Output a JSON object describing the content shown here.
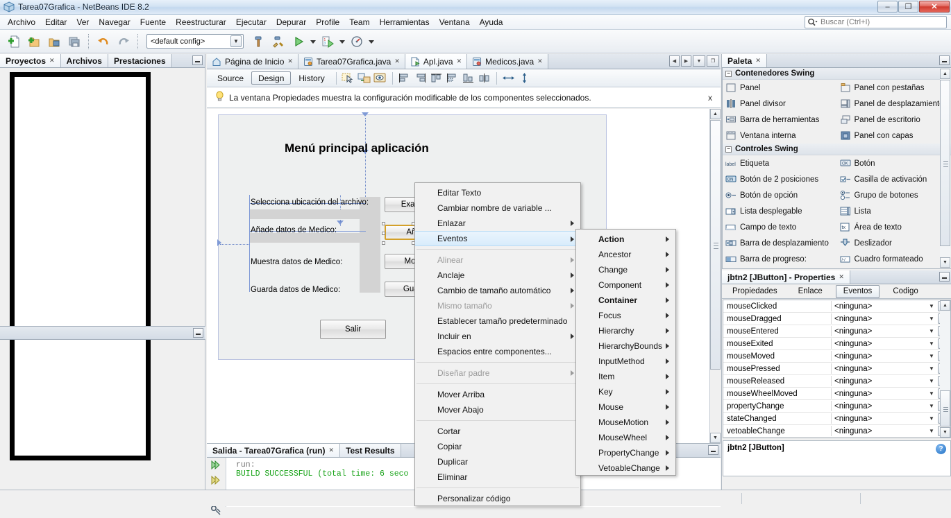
{
  "window": {
    "title": "Tarea07Grafica - NetBeans IDE 8.2",
    "app_icon": "netbeans-icon",
    "minimize": "–",
    "restore": "❐",
    "close": "✕"
  },
  "menubar": {
    "items": [
      "Archivo",
      "Editar",
      "Ver",
      "Navegar",
      "Fuente",
      "Reestructurar",
      "Ejecutar",
      "Depurar",
      "Profile",
      "Team",
      "Herramientas",
      "Ventana",
      "Ayuda"
    ]
  },
  "search": {
    "placeholder": "Buscar (Ctrl+I)",
    "icon": "search-icon"
  },
  "toolbar": {
    "config_value": "<default config>",
    "buttons": [
      "new-file-icon",
      "new-project-icon",
      "open-project-icon",
      "save-all-icon",
      "undo-icon",
      "redo-icon",
      "build-project-icon",
      "clean-build-icon",
      "run-project-icon",
      "debug-project-icon",
      "profile-project-icon"
    ]
  },
  "left_panel": {
    "tabs": [
      {
        "label": "Proyectos",
        "closable": true,
        "active": true
      },
      {
        "label": "Archivos",
        "closable": false,
        "active": false
      },
      {
        "label": "Prestaciones",
        "closable": false,
        "active": false
      }
    ],
    "minimize_label": "minimize"
  },
  "editor": {
    "tabs": [
      {
        "label": "Página de Inicio",
        "icon": "home-icon",
        "closable": true,
        "active": false
      },
      {
        "label": "Tarea07Grafica.java",
        "icon": "java-form-icon",
        "closable": true,
        "active": false
      },
      {
        "label": "Apl.java",
        "icon": "java-file-icon",
        "closable": true,
        "active": true
      },
      {
        "label": "Medicos.java",
        "icon": "java-form-icon",
        "closable": true,
        "active": false
      }
    ],
    "nav": [
      "◀",
      "▶",
      "▼",
      "❐"
    ],
    "view_tabs": [
      {
        "label": "Source",
        "selected": false
      },
      {
        "label": "Design",
        "selected": true
      },
      {
        "label": "History",
        "selected": false
      }
    ],
    "design_tools": [
      "selection-mode-icon",
      "connection-mode-icon",
      "preview-design-icon",
      "align-left-icon",
      "align-right-icon",
      "align-top-icon",
      "align-center-h-icon",
      "align-bottom-icon",
      "align-center-v-icon",
      "resize-horizontal-icon",
      "resize-vertical-icon"
    ],
    "hint": {
      "icon": "lightbulb-icon",
      "text": "La ventana Propiedades muestra la configuración modificable de los componentes seleccionados.",
      "close": "x"
    }
  },
  "design_form": {
    "title": "Menú principal aplicación",
    "rows": [
      {
        "label": "Selecciona ubicación del archivo:",
        "button": "Examinar"
      },
      {
        "label": "Añade datos de Medico:",
        "button": "Añadir",
        "selected": true
      },
      {
        "label": "Muestra datos de Medico:",
        "button": "Mostrar"
      },
      {
        "label": "Guarda datos de Medico:",
        "button": "Guardar"
      }
    ],
    "exit_button": "Salir"
  },
  "output": {
    "tabs": [
      {
        "label": "Salida - Tarea07Grafica (run)",
        "closable": true,
        "active": true
      },
      {
        "label": "Test Results",
        "closable": false,
        "active": false
      }
    ],
    "gutter_icons": [
      "run-again-icon",
      "rerun-icon",
      "stop-icon",
      "settings-icon"
    ],
    "lines": [
      {
        "text": "run:",
        "style": "run"
      },
      {
        "text": "BUILD SUCCESSFUL (total time: 6 seco",
        "style": "ok"
      }
    ]
  },
  "palette": {
    "title": "Paleta",
    "closable": true,
    "sections": [
      {
        "name": "Contenedores Swing",
        "expanded": true,
        "items": [
          {
            "label": "Panel",
            "icon": "panel-icon"
          },
          {
            "label": "Panel con pestañas",
            "icon": "tabbed-panel-icon"
          },
          {
            "label": "Panel divisor",
            "icon": "split-panel-icon"
          },
          {
            "label": "Panel de desplazamiento",
            "icon": "scroll-panel-icon"
          },
          {
            "label": "Barra de herramientas",
            "icon": "toolbar-icon"
          },
          {
            "label": "Panel de escritorio",
            "icon": "desktop-panel-icon"
          },
          {
            "label": "Ventana interna",
            "icon": "internal-frame-icon"
          },
          {
            "label": "Panel con capas",
            "icon": "layered-panel-icon"
          }
        ]
      },
      {
        "name": "Controles Swing",
        "expanded": true,
        "items": [
          {
            "label": "Etiqueta",
            "icon": "label-icon"
          },
          {
            "label": "Botón",
            "icon": "button-icon"
          },
          {
            "label": "Botón de 2 posiciones",
            "icon": "toggle-button-icon"
          },
          {
            "label": "Casilla de activación",
            "icon": "checkbox-icon"
          },
          {
            "label": "Botón de opción",
            "icon": "radio-button-icon"
          },
          {
            "label": "Grupo de botones",
            "icon": "button-group-icon"
          },
          {
            "label": "Lista desplegable",
            "icon": "combobox-icon"
          },
          {
            "label": "Lista",
            "icon": "list-icon"
          },
          {
            "label": "Campo de texto",
            "icon": "textfield-icon"
          },
          {
            "label": "Área de texto",
            "icon": "textarea-icon"
          },
          {
            "label": "Barra de desplazamiento",
            "icon": "scrollbar-icon"
          },
          {
            "label": "Deslizador",
            "icon": "slider-icon"
          },
          {
            "label": "Barra de progreso:",
            "icon": "progressbar-icon"
          },
          {
            "label": "Cuadro formateado",
            "icon": "formatted-field-icon"
          }
        ]
      }
    ]
  },
  "properties": {
    "title": "jbtn2 [JButton] - Properties",
    "closable": true,
    "tabs": [
      {
        "label": "Propiedades",
        "selected": false
      },
      {
        "label": "Enlace",
        "selected": false
      },
      {
        "label": "Eventos",
        "selected": true
      },
      {
        "label": "Codigo",
        "selected": false
      }
    ],
    "value_none": "<ninguna>",
    "ellipsis": "...",
    "events": [
      "mouseClicked",
      "mouseDragged",
      "mouseEntered",
      "mouseExited",
      "mouseMoved",
      "mousePressed",
      "mouseReleased",
      "mouseWheelMoved",
      "propertyChange",
      "stateChanged",
      "vetoableChange"
    ],
    "description": "jbtn2 [JButton]",
    "help_icon": "help-icon"
  },
  "context_menu": {
    "items": [
      {
        "label": "Editar Texto",
        "submenu": false,
        "disabled": false,
        "highlighted": false
      },
      {
        "label": "Cambiar nombre de variable ...",
        "submenu": false,
        "disabled": false,
        "highlighted": false
      },
      {
        "label": "Enlazar",
        "submenu": true,
        "disabled": false,
        "highlighted": false
      },
      {
        "label": "Eventos",
        "submenu": true,
        "disabled": false,
        "highlighted": true
      },
      {
        "separator": true
      },
      {
        "label": "Alinear",
        "submenu": true,
        "disabled": true,
        "highlighted": false
      },
      {
        "label": "Anclaje",
        "submenu": true,
        "disabled": false,
        "highlighted": false
      },
      {
        "label": "Cambio de tamaño automático",
        "submenu": true,
        "disabled": false,
        "highlighted": false
      },
      {
        "label": "Mismo tamaño",
        "submenu": true,
        "disabled": true,
        "highlighted": false
      },
      {
        "label": "Establecer tamaño predeterminado",
        "submenu": false,
        "disabled": false,
        "highlighted": false
      },
      {
        "label": "Incluir en",
        "submenu": true,
        "disabled": false,
        "highlighted": false
      },
      {
        "label": "Espacios entre componentes...",
        "submenu": false,
        "disabled": false,
        "highlighted": false
      },
      {
        "separator": true
      },
      {
        "label": "Diseñar padre",
        "submenu": true,
        "disabled": true,
        "highlighted": false
      },
      {
        "separator": true
      },
      {
        "label": "Mover Arriba",
        "submenu": false,
        "disabled": false,
        "highlighted": false
      },
      {
        "label": "Mover Abajo",
        "submenu": false,
        "disabled": false,
        "highlighted": false
      },
      {
        "separator": true
      },
      {
        "label": "Cortar",
        "submenu": false,
        "disabled": false,
        "highlighted": false
      },
      {
        "label": "Copiar",
        "submenu": false,
        "disabled": false,
        "highlighted": false
      },
      {
        "label": "Duplicar",
        "submenu": false,
        "disabled": false,
        "highlighted": false
      },
      {
        "label": "Eliminar",
        "submenu": false,
        "disabled": false,
        "highlighted": false
      },
      {
        "separator": true
      },
      {
        "label": "Personalizar código",
        "submenu": false,
        "disabled": false,
        "highlighted": false
      }
    ]
  },
  "events_submenu": {
    "items": [
      {
        "label": "Action",
        "bold": true
      },
      {
        "label": "Ancestor",
        "bold": false
      },
      {
        "label": "Change",
        "bold": false
      },
      {
        "label": "Component",
        "bold": false
      },
      {
        "label": "Container",
        "bold": true
      },
      {
        "label": "Focus",
        "bold": false
      },
      {
        "label": "Hierarchy",
        "bold": false
      },
      {
        "label": "HierarchyBounds",
        "bold": false
      },
      {
        "label": "InputMethod",
        "bold": false
      },
      {
        "label": "Item",
        "bold": false
      },
      {
        "label": "Key",
        "bold": false
      },
      {
        "label": "Mouse",
        "bold": false
      },
      {
        "label": "MouseMotion",
        "bold": false
      },
      {
        "label": "MouseWheel",
        "bold": false
      },
      {
        "label": "PropertyChange",
        "bold": false
      },
      {
        "label": "VetoableChange",
        "bold": false
      }
    ]
  },
  "colors": {
    "accent": "#3c76b8",
    "success_text": "#19a319",
    "highlight": "#d8ecfb",
    "selection_border": "#d3a02a",
    "guide": "#6b87c8"
  }
}
